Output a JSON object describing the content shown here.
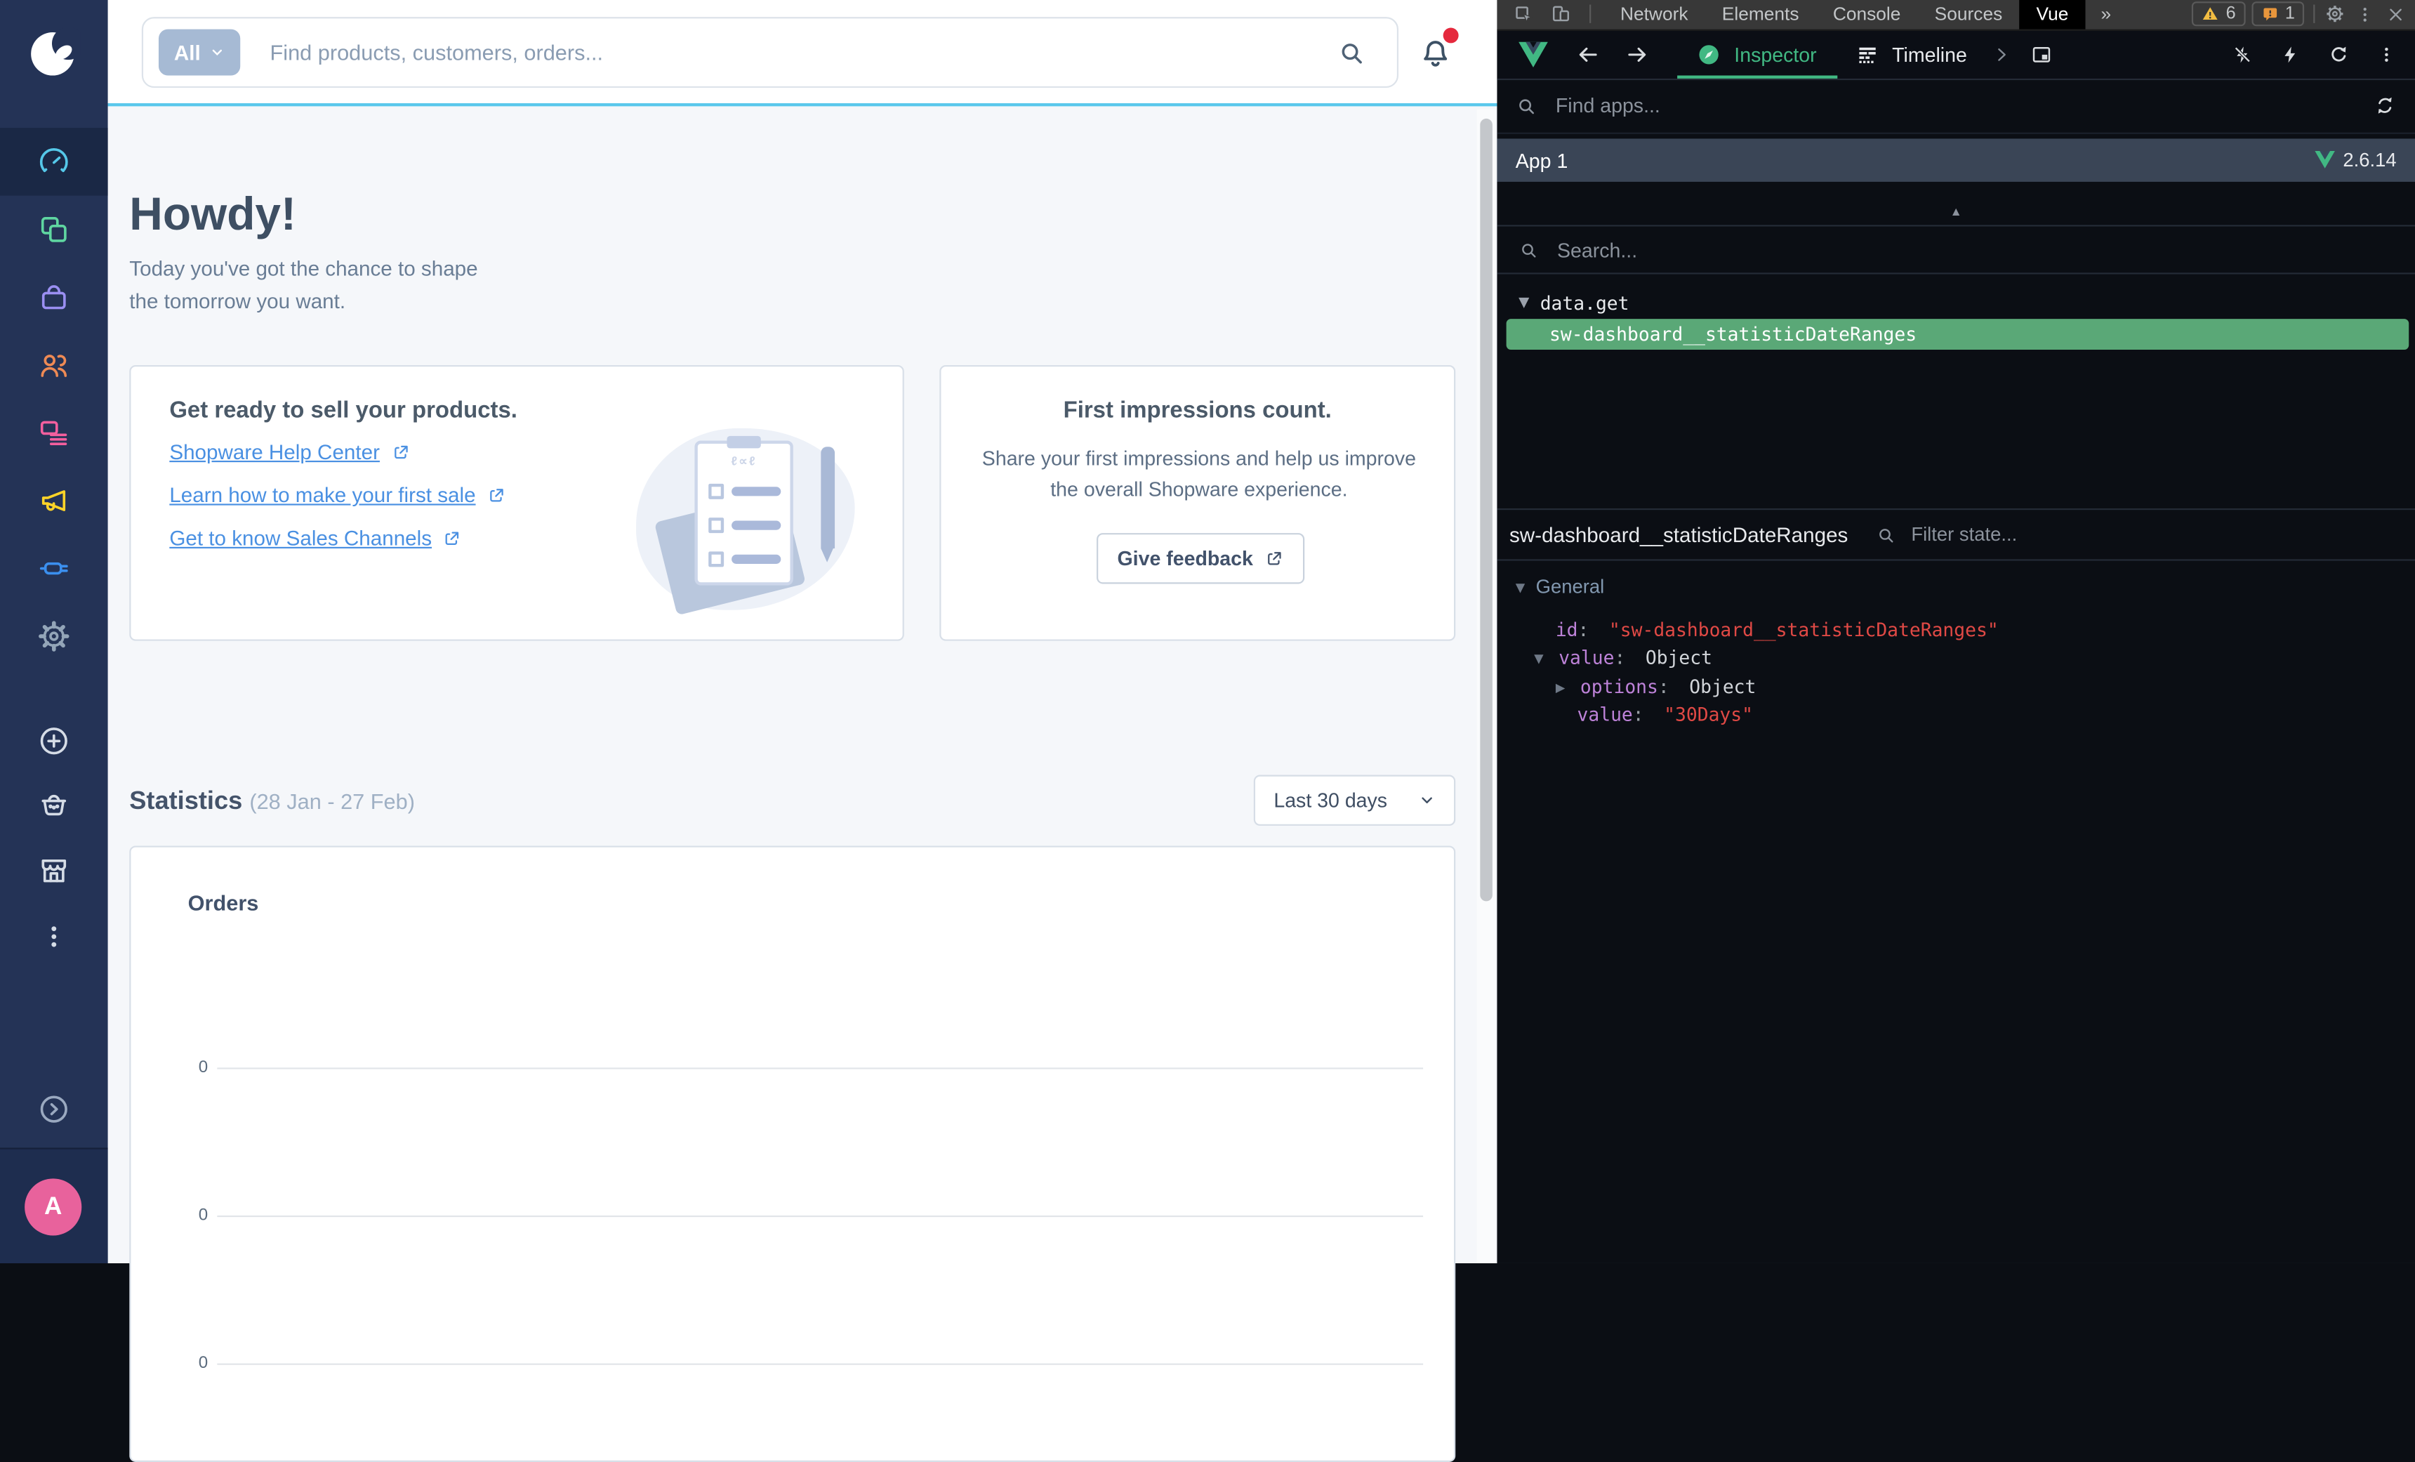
{
  "app": {
    "sidebar": {
      "items": [
        {
          "name": "dashboard",
          "color": "#55c8e9",
          "active": true
        },
        {
          "name": "catalogues",
          "color": "#5fd6a1",
          "active": false
        },
        {
          "name": "orders",
          "color": "#9a8ff2",
          "active": false
        },
        {
          "name": "customers",
          "color": "#ee8a54",
          "active": false
        },
        {
          "name": "content",
          "color": "#f35f9e",
          "active": false
        },
        {
          "name": "marketing",
          "color": "#ffd428",
          "active": false
        },
        {
          "name": "extensions",
          "color": "#3b8fee",
          "active": false
        },
        {
          "name": "settings",
          "color": "#93a5b8",
          "active": false
        }
      ],
      "secondary_items": [
        "add-sales-channel",
        "headless-sales-channel",
        "storefront",
        "more"
      ],
      "footer": {
        "avatar_initial": "A",
        "avatar_color": "#e8629c"
      }
    },
    "topbar": {
      "filter_label": "All",
      "search_placeholder": "Find products, customers, orders..."
    },
    "greeting": {
      "title": "Howdy!",
      "subtitle": "Today you've got the chance to shape the tomorrow you want."
    },
    "cards": {
      "sell": {
        "title": "Get ready to sell your products.",
        "links": [
          "Shopware Help Center",
          "Learn how to make your first sale",
          "Get to know Sales Channels"
        ]
      },
      "feedback": {
        "title": "First impressions count.",
        "body": "Share your first impressions and help us improve the overall Shopware experience.",
        "button_label": "Give feedback"
      }
    },
    "statistics": {
      "title": "Statistics",
      "range": "(28 Jan - 27 Feb)",
      "range_select": "Last 30 days"
    }
  },
  "chart_data": {
    "type": "line",
    "title": "Orders",
    "x": [],
    "series": [],
    "ylabel": "",
    "yticks": [
      "0",
      "0",
      "0"
    ],
    "grid": true
  },
  "devtools": {
    "browser_tabs": [
      "Network",
      "Elements",
      "Console",
      "Sources",
      "Vue"
    ],
    "active_tab": "Vue",
    "overflow_glyph": "»",
    "badges": {
      "warnings": "6",
      "issues": "1"
    },
    "vue_toolbar": {
      "tab_inspector": "Inspector",
      "tab_timeline": "Timeline"
    },
    "find_apps_placeholder": "Find apps...",
    "app_row": {
      "name": "App 1",
      "version": "2.6.14"
    },
    "search_placeholder": "Search...",
    "tree": {
      "group": "data.get",
      "selected": "sw-dashboard__statisticDateRanges"
    },
    "state": {
      "title": "sw-dashboard__statisticDateRanges",
      "filter_placeholder": "Filter state...",
      "section": "General",
      "rows": [
        {
          "key": "id",
          "value": "\"sw-dashboard__statisticDateRanges\""
        },
        {
          "key": "value",
          "value": "Object"
        },
        {
          "key": "options",
          "value": "Object"
        },
        {
          "key": "value",
          "value": "\"30Days\""
        }
      ]
    }
  },
  "colors": {
    "accent_cyan": "#5ac8ec",
    "link_blue": "#4a90e2",
    "vue_green": "#41b883",
    "selected_row_green": "#5aa877",
    "string_red": "#e04945",
    "key_purple": "#bd82d8",
    "sidebar_bg": "#243356",
    "warning_yellow": "#f2bd42",
    "issue_orange": "#e8963c",
    "avatar_pink": "#e8629c"
  }
}
